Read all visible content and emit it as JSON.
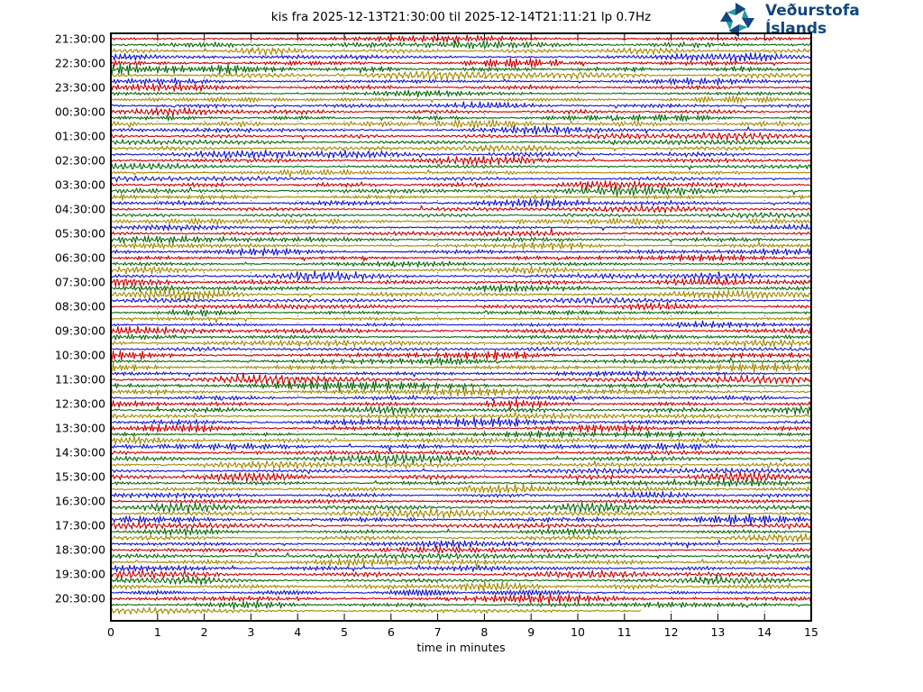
{
  "title": "kis fra 2025-12-13T21:30:00 til 2025-12-14T21:11:21 lp 0.7Hz",
  "logo": {
    "line1": "Veðurstofa",
    "line2": "Íslands"
  },
  "colors": {
    "trace_red": "#cc0000",
    "trace_green": "#0b6b0b",
    "trace_olive": "#a38a00",
    "trace_blue": "#1515d0",
    "frame": "#000000",
    "grid": "#444444",
    "logo_navy": "#10477e",
    "logo_teal": "#2397b0"
  },
  "axes": {
    "xlabel": "time in minutes",
    "x_ticks": [
      "0",
      "1",
      "2",
      "3",
      "4",
      "5",
      "6",
      "7",
      "8",
      "9",
      "10",
      "11",
      "12",
      "13",
      "14",
      "15"
    ],
    "y_ticks": [
      "21:30:00",
      "22:30:00",
      "23:30:00",
      "00:30:00",
      "01:30:00",
      "02:30:00",
      "03:30:00",
      "04:30:00",
      "05:30:00",
      "06:30:00",
      "07:30:00",
      "08:30:00",
      "09:30:00",
      "10:30:00",
      "11:30:00",
      "12:30:00",
      "13:30:00",
      "14:30:00",
      "15:30:00",
      "16:30:00",
      "17:30:00",
      "18:30:00",
      "19:30:00",
      "20:30:00"
    ]
  },
  "chart_data": {
    "type": "line",
    "variant": "helicorder-drumplot",
    "station": "kis",
    "time_start": "2025-12-13T21:30:00",
    "time_end": "2025-12-14T21:11:21",
    "filter_label": "lp 0.7Hz",
    "title": "kis fra 2025-12-13T21:30:00 til 2025-12-14T21:11:21 lp 0.7Hz",
    "xlabel": "time in minutes",
    "xlim": [
      0,
      15
    ],
    "x_tick_values": [
      0,
      1,
      2,
      3,
      4,
      5,
      6,
      7,
      8,
      9,
      10,
      11,
      12,
      13,
      14,
      15
    ],
    "row_start_labels": [
      "21:30:00",
      "22:30:00",
      "23:30:00",
      "00:30:00",
      "01:30:00",
      "02:30:00",
      "03:30:00",
      "04:30:00",
      "05:30:00",
      "06:30:00",
      "07:30:00",
      "08:30:00",
      "09:30:00",
      "10:30:00",
      "11:30:00",
      "12:30:00",
      "13:30:00",
      "14:30:00",
      "15:30:00",
      "16:30:00",
      "17:30:00",
      "18:30:00",
      "19:30:00",
      "20:30:00"
    ],
    "rows": 24,
    "minutes_per_trace": 15,
    "traces_per_row": 4,
    "trace_color_cycle": [
      "#cc0000",
      "#0b6b0b",
      "#a38a00",
      "#1515d0"
    ],
    "traces_in_last_row": 3,
    "last_trace_end_minute": 11.35,
    "grid": "dotted vertical line at each minute, inward tick marks top and bottom",
    "legend": false,
    "content": "continuous band-filtered seismic background noise with varying amplitude bursts; no isolated large events"
  }
}
